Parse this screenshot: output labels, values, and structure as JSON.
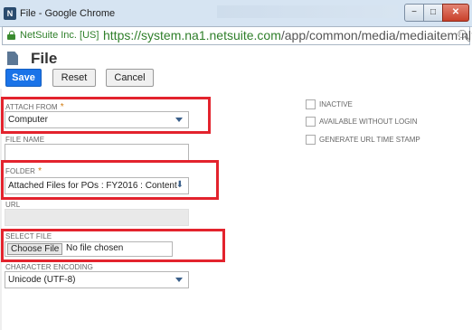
{
  "window": {
    "title": "File - Google Chrome",
    "minimize_symbol": "−",
    "maximize_symbol": "□",
    "close_symbol": "✕",
    "app_icon_text": "N"
  },
  "address_bar": {
    "cert": "NetSuite Inc. [US]",
    "url_scheme_host": "https://system.na1.netsuite.com",
    "url_path": "/app/common/media/mediaitem.nl?"
  },
  "page": {
    "title": "File"
  },
  "toolbar": {
    "save_label": "Save",
    "reset_label": "Reset",
    "cancel_label": "Cancel"
  },
  "fields": {
    "attach_from": {
      "label": "ATTACH FROM",
      "required": "*",
      "value": "Computer"
    },
    "file_name": {
      "label": "FILE NAME",
      "value": ""
    },
    "folder": {
      "label": "FOLDER",
      "required": "*",
      "value": "Attached Files for POs : FY2016 : Content"
    },
    "url": {
      "label": "URL",
      "value": ""
    },
    "select_file": {
      "label": "SELECT FILE",
      "button": "Choose File",
      "status": "No file chosen"
    },
    "character_encoding": {
      "label": "CHARACTER ENCODING",
      "value": "Unicode (UTF-8)"
    }
  },
  "checkboxes": [
    {
      "label": "INACTIVE",
      "checked": false
    },
    {
      "label": "AVAILABLE WITHOUT LOGIN",
      "checked": false
    },
    {
      "label": "GENERATE URL TIME STAMP",
      "checked": false
    }
  ],
  "annotation_color": "#e3232d",
  "accent_color": "#1a73e8"
}
